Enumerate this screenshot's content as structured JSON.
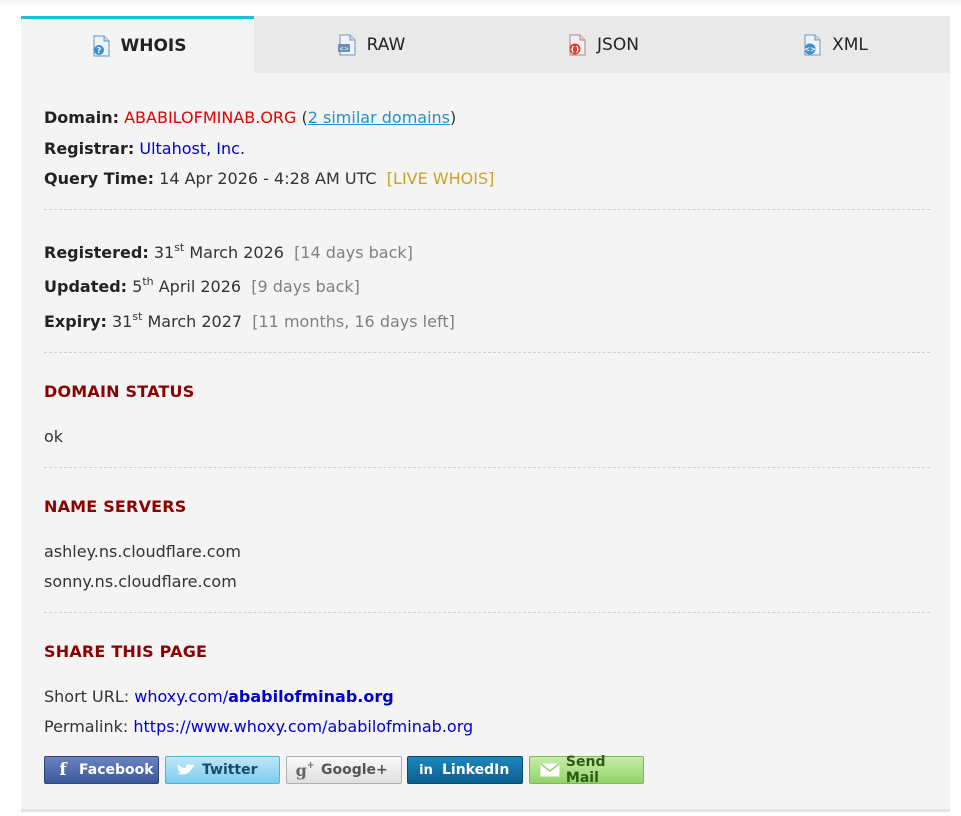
{
  "tabs": [
    {
      "label": "WHOIS",
      "icon": "whois-file-icon",
      "active": true
    },
    {
      "label": "RAW",
      "icon": "raw-file-icon",
      "active": false
    },
    {
      "label": "JSON",
      "icon": "json-file-icon",
      "active": false
    },
    {
      "label": "XML",
      "icon": "xml-file-icon",
      "active": false
    }
  ],
  "whois": {
    "domain_label": "Domain:",
    "domain_value": "ABABILOFMINAB.ORG",
    "paren_open": " (",
    "similar_link": "2 similar domains",
    "paren_close": ")",
    "registrar_label": "Registrar:",
    "registrar_value": "Ultahost, Inc.",
    "query_label": "Query Time:",
    "query_value": "14 Apr 2026 - 4:28 AM UTC",
    "live_whois": "[LIVE WHOIS]"
  },
  "dates": {
    "registered_label": "Registered:",
    "registered_day": "31",
    "registered_suffix": "st",
    "registered_rest": "March 2026",
    "registered_rel": "[14 days back]",
    "updated_label": "Updated:",
    "updated_day": "5",
    "updated_suffix": "th",
    "updated_rest": "April 2026",
    "updated_rel": "[9 days back]",
    "expiry_label": "Expiry:",
    "expiry_day": "31",
    "expiry_suffix": "st",
    "expiry_rest": "March 2027",
    "expiry_rel": "[11 months, 16 days left]"
  },
  "status": {
    "heading": "DOMAIN STATUS",
    "value": "ok"
  },
  "nameservers": {
    "heading": "NAME SERVERS",
    "items": [
      "ashley.ns.cloudflare.com",
      "sonny.ns.cloudflare.com"
    ]
  },
  "share": {
    "heading": "SHARE THIS PAGE",
    "short_url_label": "Short URL:",
    "short_url_base": "whoxy.com/",
    "short_url_path": "ababilofminab.org",
    "permalink_label": "Permalink:",
    "permalink_value": "https://www.whoxy.com/ababilofminab.org",
    "buttons": {
      "facebook": "Facebook",
      "twitter": "Twitter",
      "googleplus": "Google+",
      "linkedin": "LinkedIn",
      "sendmail": "Send Mail"
    }
  },
  "colors": {
    "active_tab_border": "#1ec0e0",
    "section_heading": "#8b0000",
    "domain_red": "#e60000",
    "link_blue": "#0000cc",
    "live_gold": "#c9a227"
  }
}
